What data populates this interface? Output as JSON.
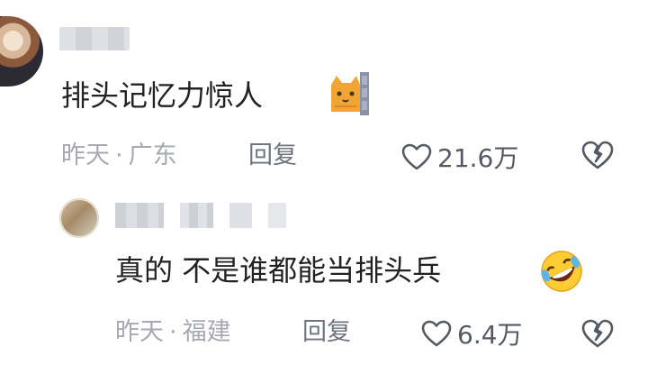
{
  "comments": [
    {
      "text": "排头记忆力惊人",
      "time": "昨天",
      "location": "广东",
      "separator": "·",
      "reply_label": "回复",
      "likes": "21.6万",
      "emoji": "cat-peeking-emoji"
    },
    {
      "text": "真的 不是谁都能当排头兵",
      "time": "昨天",
      "location": "福建",
      "separator": "·",
      "reply_label": "回复",
      "likes": "6.4万",
      "emoji": "rolling-laughing-emoji"
    }
  ],
  "colors": {
    "text": "#222222",
    "meta": "#a7a9b0",
    "reply": "#6f737b",
    "icon": "#555a62"
  }
}
